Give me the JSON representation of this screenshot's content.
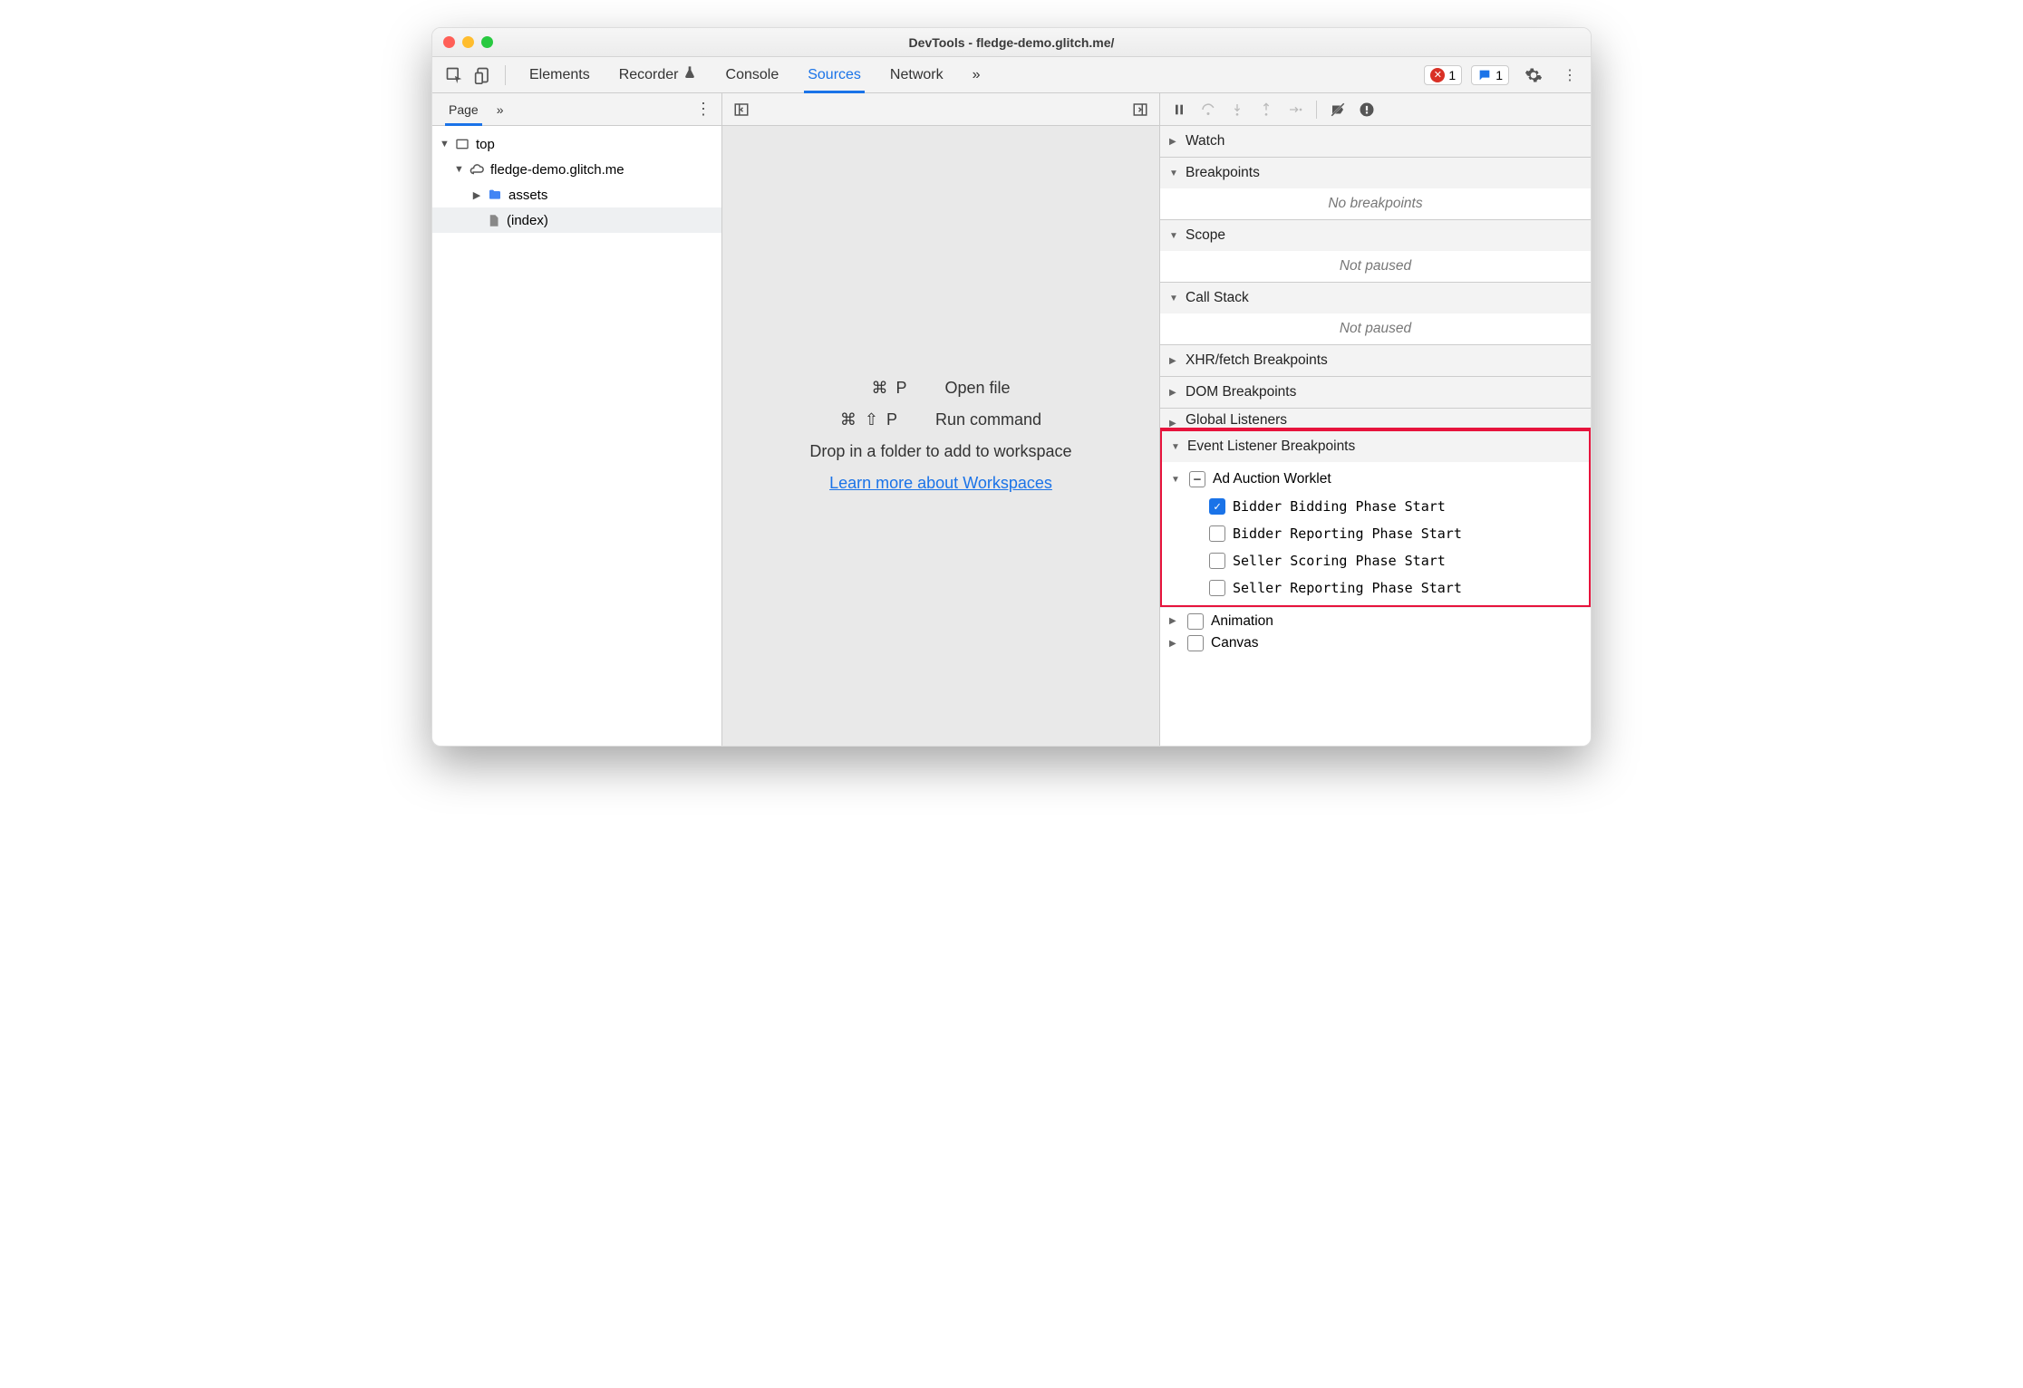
{
  "window": {
    "title": "DevTools - fledge-demo.glitch.me/"
  },
  "toolbar": {
    "tabs": [
      "Elements",
      "Recorder",
      "Console",
      "Sources",
      "Network"
    ],
    "active": "Sources",
    "more": "»",
    "errors": "1",
    "messages": "1"
  },
  "left": {
    "subtab": "Page",
    "more": "»",
    "tree": {
      "top": "top",
      "domain": "fledge-demo.glitch.me",
      "folder": "assets",
      "file": "(index)"
    }
  },
  "center": {
    "shortcut1_keys": "⌘ P",
    "shortcut1_label": "Open file",
    "shortcut2_keys": "⌘ ⇧ P",
    "shortcut2_label": "Run command",
    "hint": "Drop in a folder to add to workspace",
    "link": "Learn more about Workspaces"
  },
  "right": {
    "sections": {
      "watch": "Watch",
      "breakpoints": "Breakpoints",
      "breakpoints_body": "No breakpoints",
      "scope": "Scope",
      "scope_body": "Not paused",
      "callstack": "Call Stack",
      "callstack_body": "Not paused",
      "xhr": "XHR/fetch Breakpoints",
      "dom": "DOM Breakpoints",
      "global": "Global Listeners",
      "elb": "Event Listener Breakpoints",
      "elb_group": "Ad Auction Worklet",
      "elb_items": [
        "Bidder Bidding Phase Start",
        "Bidder Reporting Phase Start",
        "Seller Scoring Phase Start",
        "Seller Reporting Phase Start"
      ],
      "animation": "Animation",
      "canvas": "Canvas"
    }
  }
}
